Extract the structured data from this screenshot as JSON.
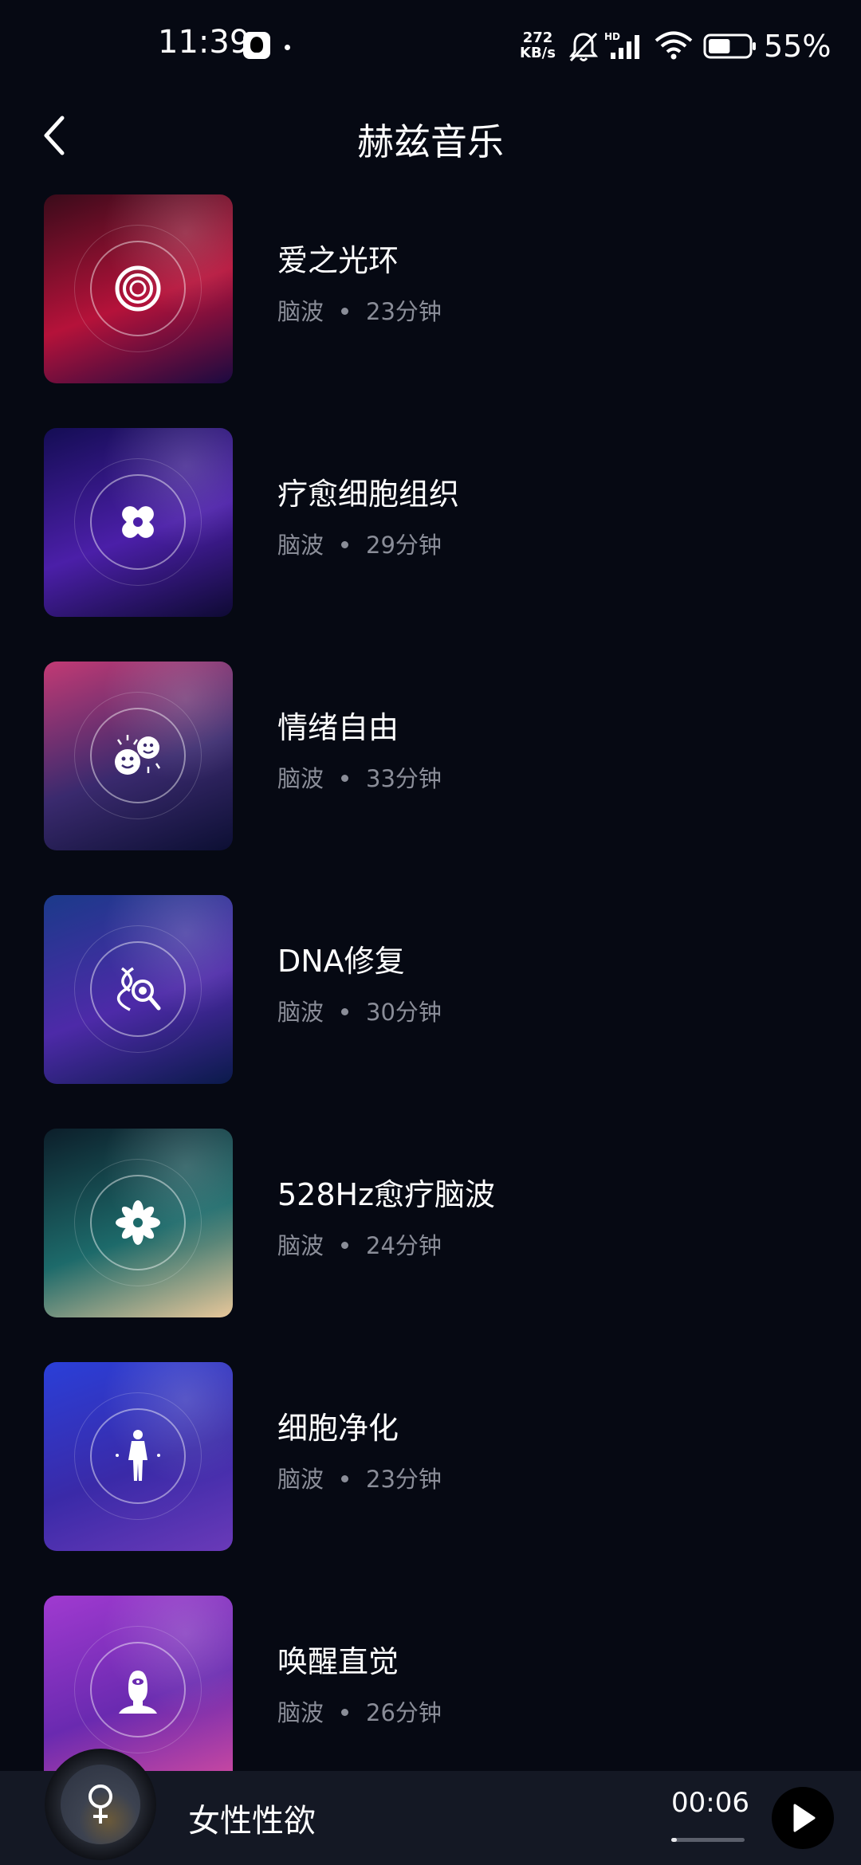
{
  "status_bar": {
    "time": "11:39",
    "net_speed_value": "272",
    "net_speed_unit": "KB/s",
    "battery_level": 0.55,
    "battery_text": "55%"
  },
  "header": {
    "title": "赫兹音乐",
    "back_icon": "chevron-left-icon"
  },
  "tracks": [
    {
      "title": "爱之光环",
      "category": "脑波",
      "duration": "23分钟",
      "icon": "concentric-circles-icon",
      "colors": [
        "#3a0b1a",
        "#b5123a",
        "#1a0a40"
      ]
    },
    {
      "title": "疗愈细胞组织",
      "category": "脑波",
      "duration": "29分钟",
      "icon": "bandage-icon",
      "colors": [
        "#140d54",
        "#4b1fa8",
        "#0e0a33"
      ]
    },
    {
      "title": "情绪自由",
      "category": "脑波",
      "duration": "33分钟",
      "icon": "mood-faces-icon",
      "colors": [
        "#c23a74",
        "#3a2a6e",
        "#0c0f33"
      ]
    },
    {
      "title": "DNA修复",
      "category": "脑波",
      "duration": "30分钟",
      "icon": "dna-magnifier-icon",
      "colors": [
        "#1b3a8a",
        "#4d2aa8",
        "#0a1a4a"
      ]
    },
    {
      "title": "528Hz愈疗脑波",
      "category": "脑波",
      "duration": "24分钟",
      "icon": "lotus-icon",
      "colors": [
        "#0c1e2a",
        "#1d6a6a",
        "#e8c79a"
      ]
    },
    {
      "title": "细胞净化",
      "category": "脑波",
      "duration": "23分钟",
      "icon": "human-body-icon",
      "colors": [
        "#2a3fd8",
        "#3a2aa8",
        "#6a3ab8"
      ]
    },
    {
      "title": "唤醒直觉",
      "category": "脑波",
      "duration": "26分钟",
      "icon": "third-eye-head-icon",
      "colors": [
        "#a03ad0",
        "#6a2ab0",
        "#d04aa0"
      ]
    }
  ],
  "player": {
    "title": "女性性欲",
    "elapsed": "00:06",
    "progress": 0.08,
    "disc_icon": "female-symbol-icon",
    "play_icon": "play-icon"
  }
}
